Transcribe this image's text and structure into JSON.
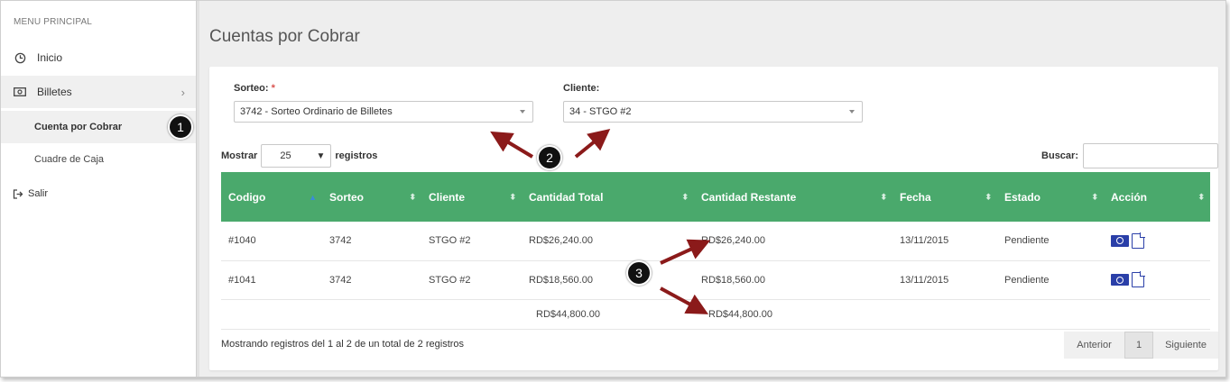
{
  "sidebar": {
    "heading": "MENU PRINCIPAL",
    "items": [
      {
        "label": "Inicio",
        "icon": "clock-icon"
      },
      {
        "label": "Billetes",
        "icon": "money-icon",
        "chevron": "›"
      },
      {
        "label": "Cuenta por Cobrar"
      },
      {
        "label": "Cuadre de Caja"
      },
      {
        "label": "Salir",
        "icon": "sign-out-icon"
      }
    ]
  },
  "page": {
    "title": "Cuentas por Cobrar"
  },
  "filters": {
    "sorteo_label": "Sorteo:",
    "required_mark": "*",
    "sorteo_value": "3742 - Sorteo Ordinario de Billetes",
    "cliente_label": "Cliente:",
    "cliente_value": "34 - STGO #2"
  },
  "table_controls": {
    "show_label": "Mostrar",
    "page_length": "25",
    "records_label": "registros",
    "search_label": "Buscar:"
  },
  "table": {
    "columns": [
      "Codigo",
      "Sorteo",
      "Cliente",
      "Cantidad Total",
      "Cantidad Restante",
      "Fecha",
      "Estado",
      "Acción"
    ],
    "rows": [
      {
        "codigo": "#1040",
        "sorteo": "3742",
        "cliente": "STGO #2",
        "total": "RD$26,240.00",
        "restante": "RD$26,240.00",
        "fecha": "13/11/2015",
        "estado": "Pendiente"
      },
      {
        "codigo": "#1041",
        "sorteo": "3742",
        "cliente": "STGO #2",
        "total": "RD$18,560.00",
        "restante": "RD$18,560.00",
        "fecha": "13/11/2015",
        "estado": "Pendiente"
      }
    ],
    "footer": {
      "total": "RD$44,800.00",
      "restante": "RD$44,800.00"
    },
    "header_color": "#4aa96c"
  },
  "pagination": {
    "info": "Mostrando registros del 1 al 2 de un total de 2 registros",
    "prev": "Anterior",
    "page": "1",
    "next": "Siguiente"
  },
  "callouts": [
    "1",
    "2",
    "3"
  ],
  "colors": {
    "arrow": "#8b1a1a",
    "action_icon": "#2a3fa8"
  }
}
